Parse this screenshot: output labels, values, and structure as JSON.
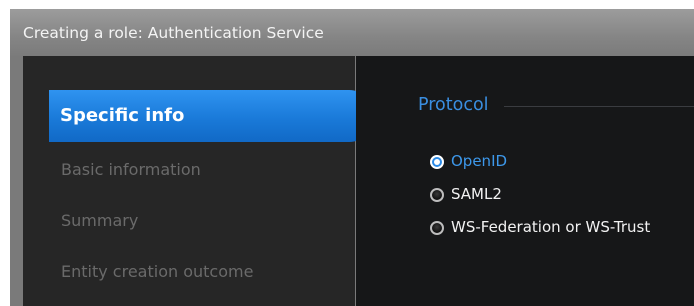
{
  "window": {
    "title": "Creating a role: Authentication Service"
  },
  "nav": {
    "items": [
      {
        "label": "Specific info",
        "state": "active"
      },
      {
        "label": "Basic information",
        "state": "inactive"
      },
      {
        "label": "Summary",
        "state": "inactive"
      },
      {
        "label": "Entity creation outcome",
        "state": "inactive"
      }
    ]
  },
  "protocol": {
    "title": "Protocol",
    "options": [
      {
        "label": "OpenID",
        "selected": true
      },
      {
        "label": "SAML2",
        "selected": false
      },
      {
        "label": "WS-Federation or WS-Trust",
        "selected": false
      }
    ]
  },
  "colors": {
    "accent": "#1a7ad9",
    "nav_background": "#262626",
    "content_background": "#161718",
    "title_bar": "#8c8c8c"
  }
}
